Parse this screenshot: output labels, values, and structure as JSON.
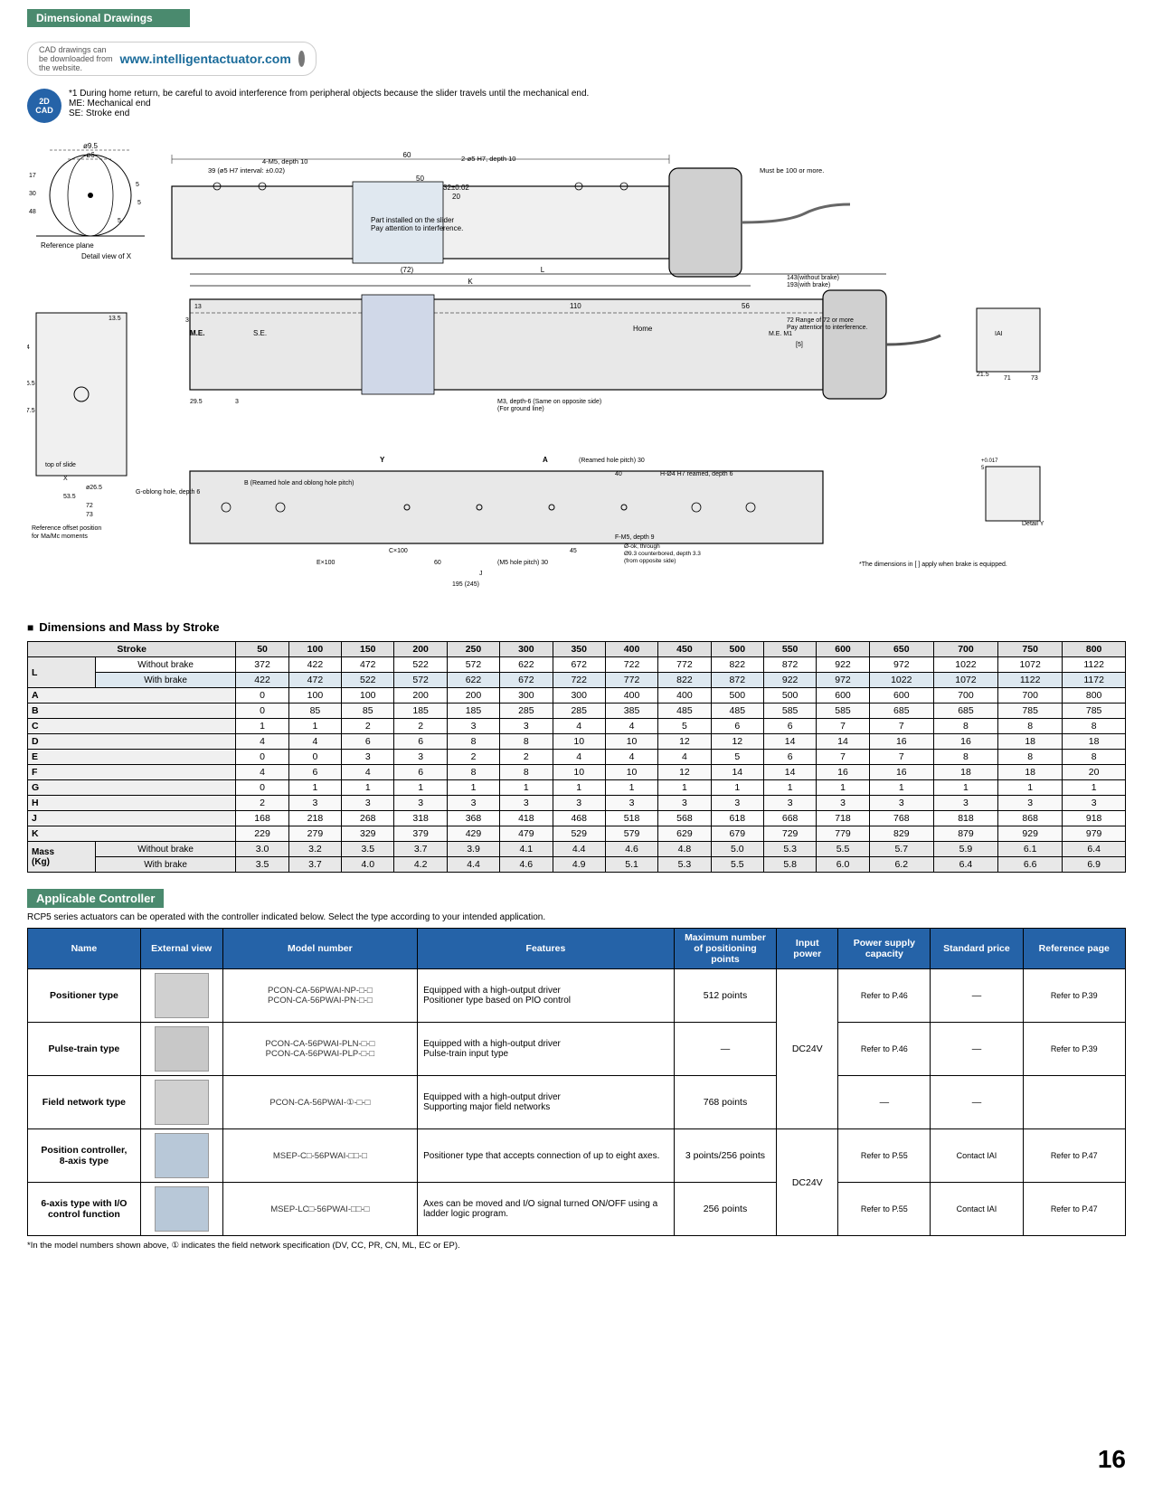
{
  "page": {
    "title": "Dimensional Drawings",
    "page_number": "16"
  },
  "cad": {
    "label": "CAD drawings can be downloaded from the website.",
    "url": "www.intelligentactuator.com",
    "badge_line1": "2D",
    "badge_line2": "CAD"
  },
  "notes": {
    "note1": "*1  During home return, be careful to avoid interference from peripheral objects because the slider travels until the mechanical end.",
    "note1a": "ME: Mechanical end",
    "note1b": "SE: Stroke end",
    "dim_note": "*The dimensions in [ ] apply when brake is equipped."
  },
  "dimensions_section": {
    "title": "Dimensions and Mass by Stroke",
    "headers": [
      "Stroke",
      "50",
      "100",
      "150",
      "200",
      "250",
      "300",
      "350",
      "400",
      "450",
      "500",
      "550",
      "600",
      "650",
      "700",
      "750",
      "800"
    ],
    "rows": [
      {
        "label": "L",
        "sub": "Without brake",
        "values": [
          "372",
          "422",
          "472",
          "522",
          "572",
          "622",
          "672",
          "722",
          "772",
          "822",
          "872",
          "922",
          "972",
          "1022",
          "1072",
          "1122"
        ]
      },
      {
        "label": "",
        "sub": "With brake",
        "values": [
          "422",
          "472",
          "522",
          "572",
          "622",
          "672",
          "722",
          "772",
          "822",
          "872",
          "922",
          "972",
          "1022",
          "1072",
          "1122",
          "1172"
        ]
      },
      {
        "label": "A",
        "sub": "",
        "values": [
          "0",
          "100",
          "100",
          "200",
          "200",
          "300",
          "300",
          "400",
          "400",
          "500",
          "500",
          "600",
          "600",
          "700",
          "700",
          "800"
        ]
      },
      {
        "label": "B",
        "sub": "",
        "values": [
          "0",
          "85",
          "85",
          "185",
          "185",
          "285",
          "285",
          "385",
          "485",
          "485",
          "585",
          "585",
          "685",
          "685",
          "785",
          "785"
        ]
      },
      {
        "label": "C",
        "sub": "",
        "values": [
          "1",
          "1",
          "2",
          "2",
          "3",
          "3",
          "4",
          "4",
          "5",
          "6",
          "6",
          "7",
          "7",
          "8",
          "8",
          "8"
        ]
      },
      {
        "label": "D",
        "sub": "",
        "values": [
          "4",
          "4",
          "6",
          "6",
          "8",
          "8",
          "10",
          "10",
          "12",
          "12",
          "14",
          "14",
          "16",
          "16",
          "18",
          "18"
        ]
      },
      {
        "label": "E",
        "sub": "",
        "values": [
          "0",
          "0",
          "3",
          "3",
          "2",
          "2",
          "4",
          "4",
          "4",
          "5",
          "6",
          "7"
        ]
      },
      {
        "label": "F",
        "sub": "",
        "values": [
          "4",
          "6",
          "4",
          "6",
          "8",
          "8",
          "10",
          "10",
          "12",
          "14",
          "14",
          "16",
          "16",
          "18",
          "18",
          "20"
        ]
      },
      {
        "label": "G",
        "sub": "",
        "values": [
          "0",
          "1",
          "1",
          "1",
          "1",
          "1",
          "1",
          "1",
          "1",
          "1",
          "1",
          "1",
          "1",
          "1",
          "1",
          "1"
        ]
      },
      {
        "label": "H",
        "sub": "",
        "values": [
          "2",
          "3",
          "3",
          "3",
          "3",
          "3",
          "3",
          "3",
          "3",
          "3",
          "3",
          "3",
          "3",
          "3",
          "3",
          "3"
        ]
      },
      {
        "label": "J",
        "sub": "",
        "values": [
          "168",
          "218",
          "268",
          "318",
          "368",
          "418",
          "468",
          "518",
          "568",
          "618",
          "668",
          "718",
          "768",
          "818",
          "868",
          "918"
        ]
      },
      {
        "label": "K",
        "sub": "",
        "values": [
          "229",
          "279",
          "329",
          "379",
          "429",
          "479",
          "529",
          "579",
          "629",
          "679",
          "729",
          "779",
          "829",
          "879",
          "929",
          "979"
        ]
      },
      {
        "label": "Mass (Kg)",
        "sub": "Without brake",
        "values": [
          "3.0",
          "3.2",
          "3.5",
          "3.7",
          "3.9",
          "4.1",
          "4.4",
          "4.6",
          "4.8",
          "5.0",
          "5.3",
          "5.5",
          "5.7",
          "5.9",
          "6.1",
          "6.4"
        ]
      },
      {
        "label": "",
        "sub": "With brake",
        "values": [
          "3.5",
          "3.7",
          "4.0",
          "4.2",
          "4.4",
          "4.6",
          "4.9",
          "5.1",
          "5.3",
          "5.5",
          "5.8",
          "6.0",
          "6.2",
          "6.4",
          "6.6",
          "6.9"
        ]
      }
    ]
  },
  "applicable_controller": {
    "title": "Applicable Controller",
    "note": "RCP5 series actuators can be operated with the controller indicated below. Select the type according to your intended application.",
    "headers": {
      "name": "Name",
      "external_view": "External view",
      "model_number": "Model number",
      "features": "Features",
      "max_positioning": "Maximum number of positioning points",
      "input_power": "Input power",
      "power_supply_capacity": "Power supply capacity",
      "standard_price": "Standard price",
      "reference_page": "Reference page"
    },
    "rows": [
      {
        "name": "Positioner type",
        "model": "PCON-CA-56PWAI-NP-□-□\nPCON-CA-56PWAI-PN-□-□",
        "features": "Equipped with a high-output driver\nPositioner type based on PIO control",
        "max_points": "512 points",
        "input_power": "DC24V",
        "power_supply": "Refer to P.46",
        "standard_price": "—",
        "ref_page": "Refer to P.39"
      },
      {
        "name": "Pulse-train type",
        "model": "PCON-CA-56PWAI-PLN-□-□\nPCON-CA-56PWAI-PLP-□-□",
        "features": "Equipped with a high-output driver\nPulse-train input type",
        "max_points": "—",
        "input_power": "DC24V",
        "power_supply": "Refer to P.46",
        "standard_price": "—",
        "ref_page": "Refer to P.39"
      },
      {
        "name": "Field network type",
        "model": "PCON-CA-56PWAI-①-□-□",
        "features": "Equipped with a high-output driver\nSupporting major field networks",
        "max_points": "768 points",
        "input_power": "DC24V",
        "power_supply": "—",
        "standard_price": "—",
        "ref_page": ""
      },
      {
        "name": "Position controller,\n8-axis type",
        "model": "MSEP-C□-56PWAI-□□-□",
        "features": "Positioner type that accepts connection of up to eight axes.",
        "max_points": "3 points/256 points",
        "input_power": "DC24V",
        "power_supply": "Refer to P.55",
        "standard_price": "Contact IAI",
        "ref_page": "Refer to P.47"
      },
      {
        "name": "6-axis type with I/O control function",
        "model": "MSEP-LC□-56PWAI-□□-□",
        "features": "Axes can be moved and I/O signal turned ON/OFF using a ladder logic program.",
        "max_points": "256 points",
        "input_power": "DC24V",
        "power_supply": "Refer to P.55",
        "standard_price": "Contact IAI",
        "ref_page": "Refer to P.47"
      }
    ],
    "footnote": "*In the model numbers shown above, ① indicates the field network specification (DV, CC, PR, CN, ML, EC or EP)."
  }
}
